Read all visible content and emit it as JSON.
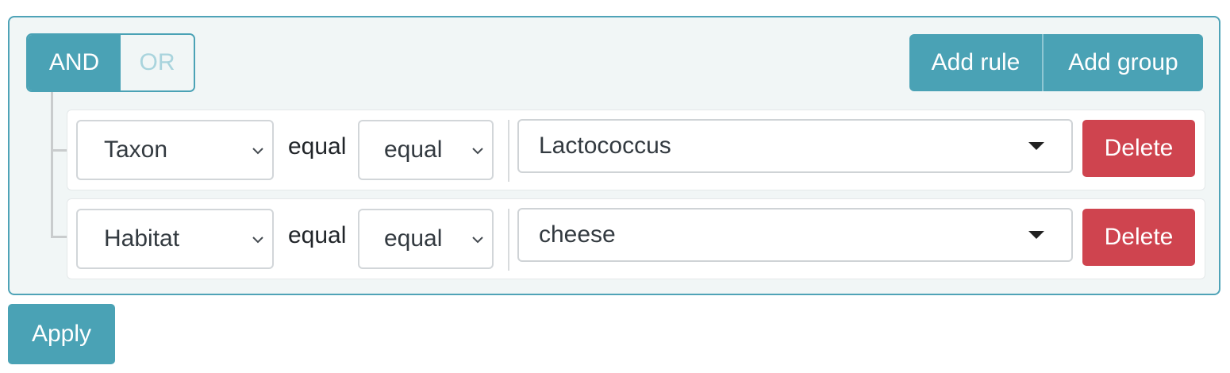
{
  "group": {
    "conditions": [
      "AND",
      "OR"
    ],
    "active_condition": "AND",
    "add_rule_label": "Add rule",
    "add_group_label": "Add group"
  },
  "rules": [
    {
      "field": "Taxon",
      "operator_label": "equal",
      "operator": "equal",
      "value": "Lactococcus",
      "delete_label": "Delete"
    },
    {
      "field": "Habitat",
      "operator_label": "equal",
      "operator": "equal",
      "value": "cheese",
      "delete_label": "Delete"
    }
  ],
  "apply_label": "Apply",
  "colors": {
    "accent": "#4aa2b5",
    "danger": "#cf444f",
    "group_background": "#f1f6f6"
  },
  "icons": {
    "select_chevron": "chevron-down-icon",
    "value_dropdown": "caret-down-icon"
  }
}
